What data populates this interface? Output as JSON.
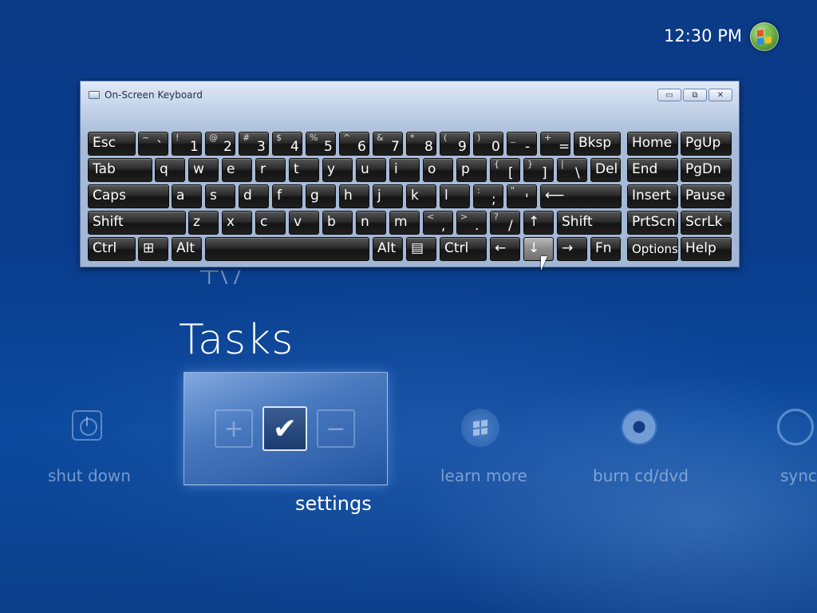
{
  "clock": {
    "time": "12:30 PM"
  },
  "colors": {
    "accent": "#0b3a86",
    "keycap": "#1f1f1f"
  },
  "media_center": {
    "menu_partial": "TV",
    "section_title": "Tasks",
    "tiles": {
      "shut_down": "shut down",
      "settings": "settings",
      "learn_more": "learn more",
      "burn": "burn cd/dvd",
      "sync": "sync"
    },
    "settings_icons": {
      "plus": "+",
      "check": "✔",
      "minus": "−"
    }
  },
  "osk": {
    "title": "On-Screen Keyboard",
    "caption": {
      "minimize": "▭",
      "restore": "⧉",
      "close": "✕"
    },
    "row1": [
      {
        "main": "Esc"
      },
      {
        "top": "~",
        "bot": "`"
      },
      {
        "top": "!",
        "bot": "1"
      },
      {
        "top": "@",
        "bot": "2"
      },
      {
        "top": "#",
        "bot": "3"
      },
      {
        "top": "$",
        "bot": "4"
      },
      {
        "top": "%",
        "bot": "5"
      },
      {
        "top": "^",
        "bot": "6"
      },
      {
        "top": "&",
        "bot": "7"
      },
      {
        "top": "*",
        "bot": "8"
      },
      {
        "top": "(",
        "bot": "9"
      },
      {
        "top": ")",
        "bot": "0"
      },
      {
        "top": "_",
        "bot": "-"
      },
      {
        "top": "+",
        "bot": "="
      },
      {
        "main": "Bksp"
      }
    ],
    "row2": [
      {
        "main": "Tab"
      },
      {
        "main": "q"
      },
      {
        "main": "w"
      },
      {
        "main": "e"
      },
      {
        "main": "r"
      },
      {
        "main": "t"
      },
      {
        "main": "y"
      },
      {
        "main": "u"
      },
      {
        "main": "i"
      },
      {
        "main": "o"
      },
      {
        "main": "p"
      },
      {
        "top": "{",
        "bot": "["
      },
      {
        "top": "}",
        "bot": "]"
      },
      {
        "top": "|",
        "bot": "\\"
      },
      {
        "main": "Del"
      }
    ],
    "row3": [
      {
        "main": "Caps"
      },
      {
        "main": "a"
      },
      {
        "main": "s"
      },
      {
        "main": "d"
      },
      {
        "main": "f"
      },
      {
        "main": "g"
      },
      {
        "main": "h"
      },
      {
        "main": "j"
      },
      {
        "main": "k"
      },
      {
        "main": "l"
      },
      {
        "top": ":",
        "bot": ";"
      },
      {
        "top": "\"",
        "bot": "'"
      },
      {
        "main": "⟵"
      }
    ],
    "row4": [
      {
        "main": "Shift"
      },
      {
        "main": "z"
      },
      {
        "main": "x"
      },
      {
        "main": "c"
      },
      {
        "main": "v"
      },
      {
        "main": "b"
      },
      {
        "main": "n"
      },
      {
        "main": "m"
      },
      {
        "top": "<",
        "bot": ","
      },
      {
        "top": ">",
        "bot": "."
      },
      {
        "top": "?",
        "bot": "/"
      },
      {
        "main": "↑"
      },
      {
        "main": "Shift"
      }
    ],
    "row5": [
      {
        "main": "Ctrl"
      },
      {
        "main": "⊞"
      },
      {
        "main": "Alt"
      },
      {
        "main": ""
      },
      {
        "main": "Alt"
      },
      {
        "main": "▤"
      },
      {
        "main": "Ctrl"
      },
      {
        "main": "←"
      },
      {
        "main": "↓"
      },
      {
        "main": "→"
      },
      {
        "main": "Fn"
      }
    ],
    "nav": {
      "home": "Home",
      "pgup": "PgUp",
      "end": "End",
      "pgdn": "PgDn",
      "insert": "Insert",
      "pause": "Pause",
      "prtscn": "PrtScn",
      "scrlk": "ScrLk",
      "options": "Options",
      "help": "Help"
    }
  }
}
